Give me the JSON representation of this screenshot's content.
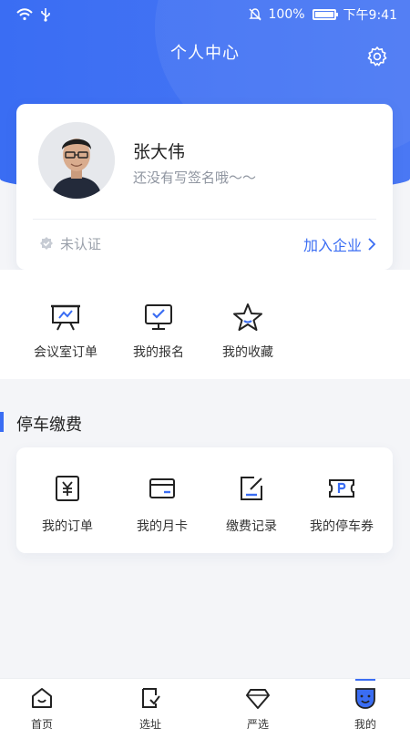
{
  "status_bar": {
    "battery": "100%",
    "time": "下午9:41"
  },
  "header": {
    "title": "个人中心"
  },
  "profile": {
    "name": "张大伟",
    "signature": "还没有写签名哦～～",
    "cert_status": "未认证",
    "join_link": "加入企业"
  },
  "quick_links": [
    {
      "label": "会议室订单",
      "icon": "presentation-icon"
    },
    {
      "label": "我的报名",
      "icon": "monitor-check-icon"
    },
    {
      "label": "我的收藏",
      "icon": "star-icon"
    }
  ],
  "parking": {
    "title": "停车缴费",
    "items": [
      {
        "label": "我的订单",
        "icon": "yen-icon"
      },
      {
        "label": "我的月卡",
        "icon": "card-icon"
      },
      {
        "label": "缴费记录",
        "icon": "edit-note-icon"
      },
      {
        "label": "我的停车券",
        "icon": "parking-ticket-icon"
      }
    ]
  },
  "tabs": [
    {
      "label": "首页",
      "icon": "home-icon"
    },
    {
      "label": "选址",
      "icon": "location-select-icon"
    },
    {
      "label": "严选",
      "icon": "diamond-icon"
    },
    {
      "label": "我的",
      "icon": "face-icon",
      "active": true
    }
  ],
  "colors": {
    "accent": "#3a6df3"
  }
}
